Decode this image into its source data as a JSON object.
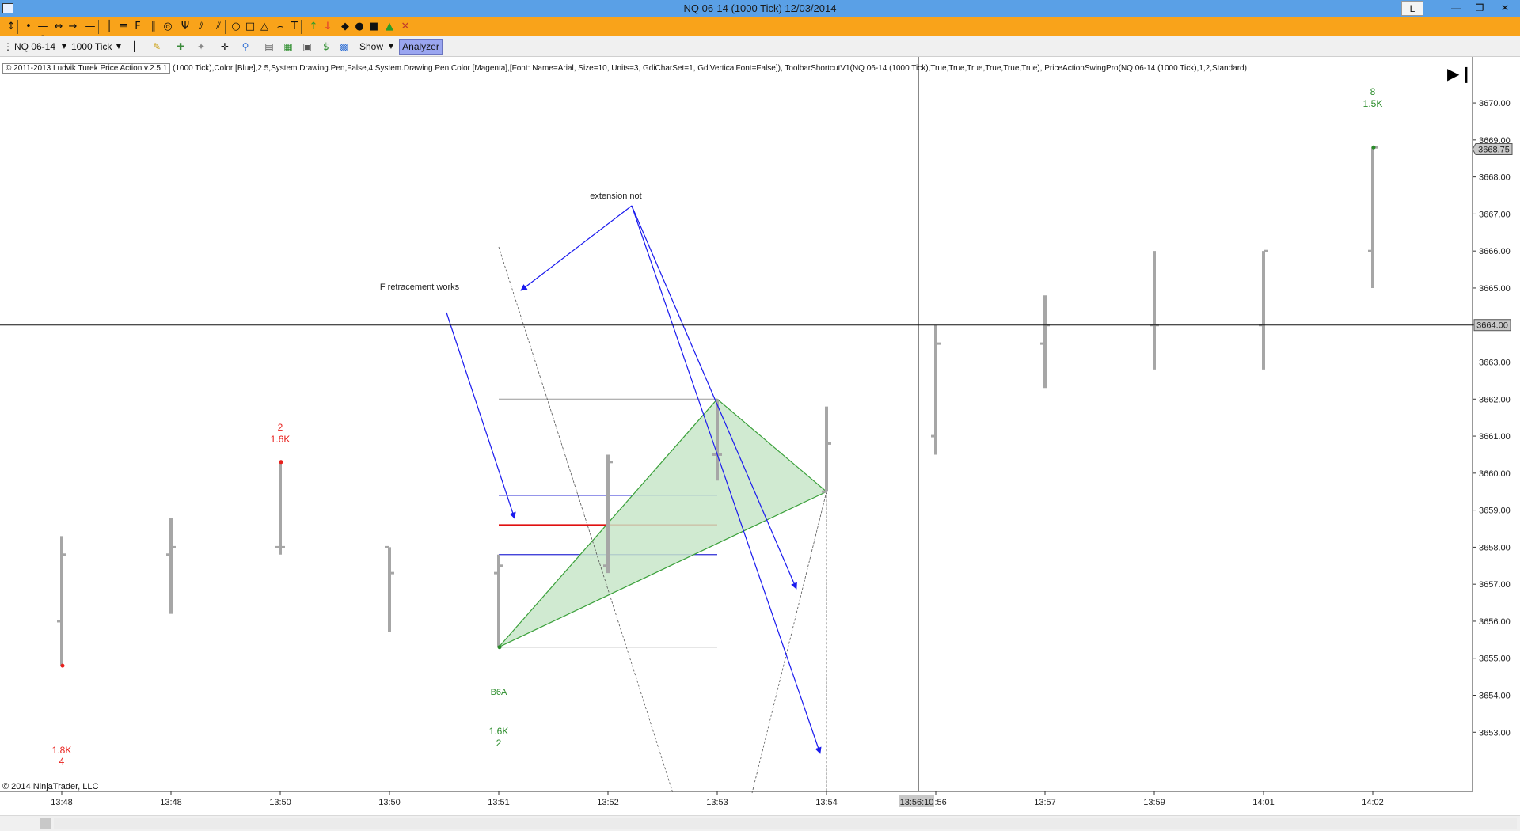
{
  "window": {
    "title": "NQ 06-14 (1000 Tick)  12/03/2014",
    "layout_button": "L",
    "minimize_icon": "minimize-icon",
    "maximize_icon": "restore-icon",
    "close_icon": "close-icon"
  },
  "toolbar_drawing": {
    "icons": [
      "cursor-icon",
      "ray-icon",
      "extended-line-icon",
      "arrow-line-icon",
      "horizontal-line-icon",
      "vertical-line-icon",
      "fibonacci-retracement-icon",
      "fibonacci-extension-icon",
      "fibonacci-time-icon",
      "fibonacci-circle-icon",
      "andrews-pitchfork-icon",
      "gann-fan-icon",
      "regression-channel-icon",
      "ellipse-icon",
      "rectangle-icon",
      "triangle-icon",
      "arc-icon",
      "text-icon",
      "arrow-up-icon",
      "arrow-down-icon",
      "diamond-icon",
      "dot-icon",
      "square-icon",
      "triangle-up-icon",
      "triangle-down-icon",
      "remove-drawings-icon"
    ]
  },
  "toolbar_chart": {
    "instrument": "NQ 06-14",
    "interval": "1000 Tick",
    "show_label": "Show",
    "analyzer_label": "Analyzer"
  },
  "chart": {
    "copyright_top": "© 2011-2013 Ludvik Turek Price Action v.2.5.1",
    "indicator_params": "(1000 Tick),Color [Blue],2.5,System.Drawing.Pen,False,4,System.Drawing.Pen,Color [Magenta],[Font: Name=Arial, Size=10, Units=3, GdiCharSet=1, GdiVerticalFont=False]), ToolbarShortcutV1(NQ 06-14 (1000 Tick),True,True,True,True,True,True), PriceActionSwingPro(NQ 06-14 (1000 Tick),1,2,Standard)",
    "copyright_bottom": "© 2014 NinjaTrader, LLC",
    "annotations": {
      "f_retracement": "F retracement works",
      "extension_not": "extension not",
      "b6a_label": "B6A"
    },
    "crosshair": {
      "price_label": "3664.00",
      "time_label": "13:56:10"
    },
    "last_price_label": "3668.75",
    "swing_labels": [
      {
        "line1": "1.8K",
        "line2": "4",
        "color": "#e8201c"
      },
      {
        "line1": "2",
        "line2": "1.6K",
        "color": "#e8201c"
      },
      {
        "line1": "1.6K",
        "line2": "2",
        "color": "#2a8c2a"
      },
      {
        "line1": "8",
        "line2": "1.5K",
        "color": "#2a8c2a"
      }
    ],
    "price_axis_labels": [
      "3670.00",
      "3669.00",
      "3668.00",
      "3667.00",
      "3666.00",
      "3665.00",
      "3664.00",
      "3663.00",
      "3662.00",
      "3661.00",
      "3660.00",
      "3659.00",
      "3658.00",
      "3657.00",
      "3656.00",
      "3655.00",
      "3654.00",
      "3653.00"
    ],
    "time_axis_labels": [
      "13:48",
      "13:48",
      "13:50",
      "13:50",
      "13:51",
      "13:52",
      "13:53",
      "13:54",
      "13:56",
      "13:57",
      "13:59",
      "14:01",
      "14:02"
    ],
    "colors": {
      "bar": "#a6a6a6",
      "fib_line": "#2b2bd4",
      "fib_mid": "#e01010",
      "triangle_fill": "#c8e6c9",
      "triangle_stroke": "#3aa03a",
      "arrow": "#1a1aee"
    }
  },
  "chart_data": {
    "type": "ohlc",
    "title": "",
    "instrument": "NQ 06-14",
    "interval": "1000 Tick",
    "xlabel": "",
    "ylabel": "",
    "ylim": [
      3652.6,
      3670.6
    ],
    "bars": [
      {
        "time": "13:48",
        "open": 3656.0,
        "high": 3658.3,
        "low": 3654.8,
        "close": 3657.8
      },
      {
        "time": "13:48",
        "open": 3657.8,
        "high": 3658.8,
        "low": 3656.2,
        "close": 3658.0
      },
      {
        "time": "13:50",
        "open": 3658.0,
        "high": 3660.3,
        "low": 3657.8,
        "close": 3658.0
      },
      {
        "time": "13:50",
        "open": 3658.0,
        "high": 3658.0,
        "low": 3655.7,
        "close": 3657.3
      },
      {
        "time": "13:51",
        "open": 3657.3,
        "high": 3657.8,
        "low": 3655.3,
        "close": 3657.5
      },
      {
        "time": "13:52",
        "open": 3657.5,
        "high": 3660.5,
        "low": 3657.3,
        "close": 3660.3
      },
      {
        "time": "13:53",
        "open": 3660.5,
        "high": 3662.0,
        "low": 3659.8,
        "close": 3660.5
      },
      {
        "time": "13:54",
        "open": 3659.5,
        "high": 3661.8,
        "low": 3659.5,
        "close": 3660.8
      },
      {
        "time": "13:56",
        "open": 3661.0,
        "high": 3664.0,
        "low": 3660.5,
        "close": 3663.5
      },
      {
        "time": "13:57",
        "open": 3663.5,
        "high": 3664.8,
        "low": 3662.3,
        "close": 3664.0
      },
      {
        "time": "13:59",
        "open": 3664.0,
        "high": 3666.0,
        "low": 3662.8,
        "close": 3664.0
      },
      {
        "time": "14:01",
        "open": 3664.0,
        "high": 3666.0,
        "low": 3662.8,
        "close": 3666.0
      },
      {
        "time": "14:02",
        "open": 3666.0,
        "high": 3668.8,
        "low": 3665.0,
        "close": 3668.8
      }
    ],
    "fib_levels": [
      3662.0,
      3659.4,
      3658.6,
      3657.8,
      3655.3
    ],
    "swing_points": [
      3655.3,
      3662.0,
      3659.5
    ]
  }
}
